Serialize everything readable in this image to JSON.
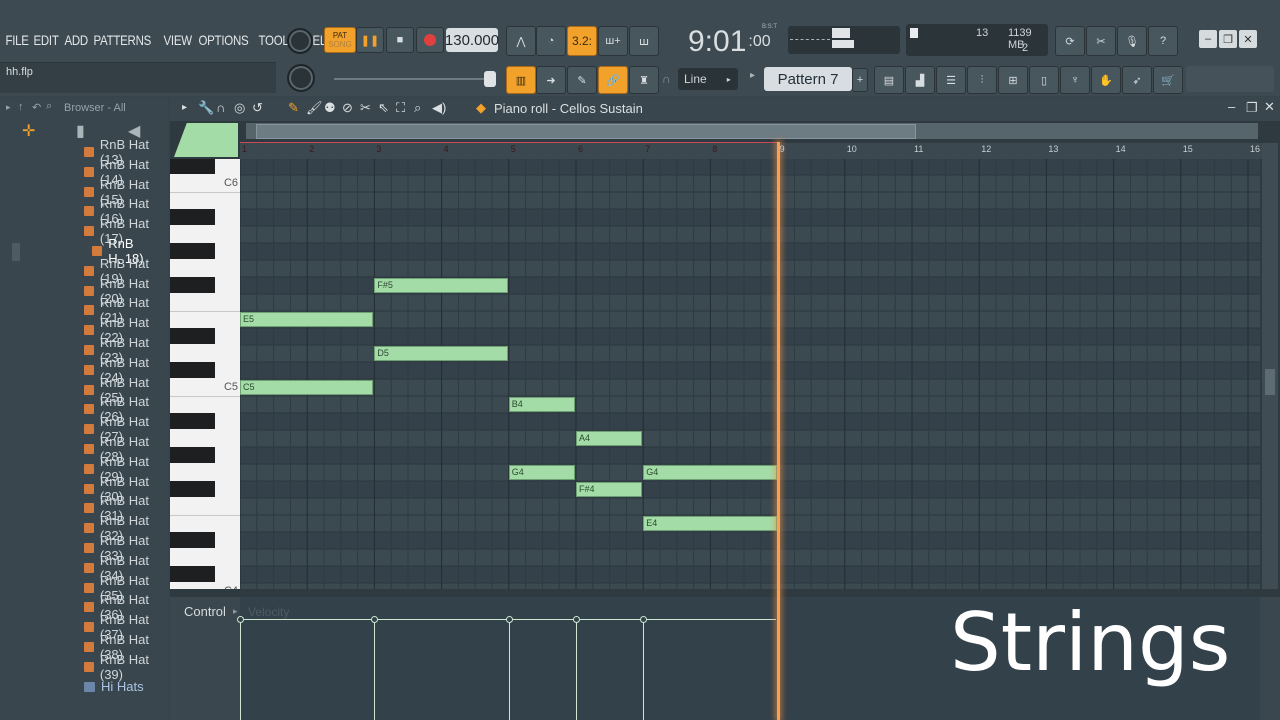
{
  "menu": [
    "FILE",
    "EDIT",
    "ADD",
    "PATTERNS",
    "VIEW",
    "OPTIONS",
    "TOOLS",
    "HELP"
  ],
  "file_hint": "hh.flp",
  "transport": {
    "pat_label": "PAT",
    "song_label": "SONG",
    "tempo": "130.000",
    "time_main": "9:01",
    "time_sub": ":00",
    "time_mode": "B:S:T",
    "snap": "3.2:"
  },
  "cpu": {
    "polyphony": "13",
    "memory": "1139 MB",
    "voices": "2"
  },
  "line_mode": "Line",
  "pattern": "Pattern 7",
  "browser": {
    "title": "Browser - All",
    "items": [
      "RnB Hat (13)",
      "RnB Hat (14)",
      "RnB Hat (15)",
      "RnB Hat (16)",
      "RnB Hat (17)",
      "RnB H..18)",
      "RnB Hat (19)",
      "RnB Hat (20)",
      "RnB Hat (21)",
      "RnB Hat (22)",
      "RnB Hat (23)",
      "RnB Hat (24)",
      "RnB Hat (25)",
      "RnB Hat (26)",
      "RnB Hat (27)",
      "RnB Hat (28)",
      "RnB Hat (29)",
      "RnB Hat (30)",
      "RnB Hat (31)",
      "RnB Hat (32)",
      "RnB Hat (33)",
      "RnB Hat (34)",
      "RnB Hat (35)",
      "RnB Hat (36)",
      "RnB Hat (37)",
      "RnB Hat (38)",
      "RnB Hat (39)",
      "Hi Hats"
    ],
    "selected_index": 5,
    "folder_index": 27
  },
  "piano_roll": {
    "title": "Piano roll - Cellos Sustain",
    "bars": [
      "1",
      "2",
      "3",
      "4",
      "5",
      "6",
      "7",
      "8",
      "9",
      "10",
      "11",
      "12",
      "13",
      "14",
      "15",
      "16"
    ],
    "key_labels": [
      "C6",
      "C5",
      "C4"
    ],
    "control_label": "Control",
    "control_target": "Velocity",
    "notes": [
      {
        "name": "F#5",
        "start": 3,
        "length": 2,
        "pitch": "F#5"
      },
      {
        "name": "E5",
        "start": 1,
        "length": 2,
        "pitch": "E5"
      },
      {
        "name": "D5",
        "start": 3,
        "length": 2,
        "pitch": "D5"
      },
      {
        "name": "C5",
        "start": 1,
        "length": 2,
        "pitch": "C5"
      },
      {
        "name": "B4",
        "start": 5,
        "length": 1,
        "pitch": "B4"
      },
      {
        "name": "A4",
        "start": 6,
        "length": 1,
        "pitch": "A4"
      },
      {
        "name": "G4",
        "start": 5,
        "length": 1,
        "pitch": "G4"
      },
      {
        "name": "G4",
        "start": 7,
        "length": 2,
        "pitch": "G4"
      },
      {
        "name": "F#4",
        "start": 6,
        "length": 1,
        "pitch": "F#4"
      },
      {
        "name": "E4",
        "start": 7,
        "length": 2,
        "pitch": "E4"
      }
    ]
  },
  "overlay_caption": "Strings"
}
